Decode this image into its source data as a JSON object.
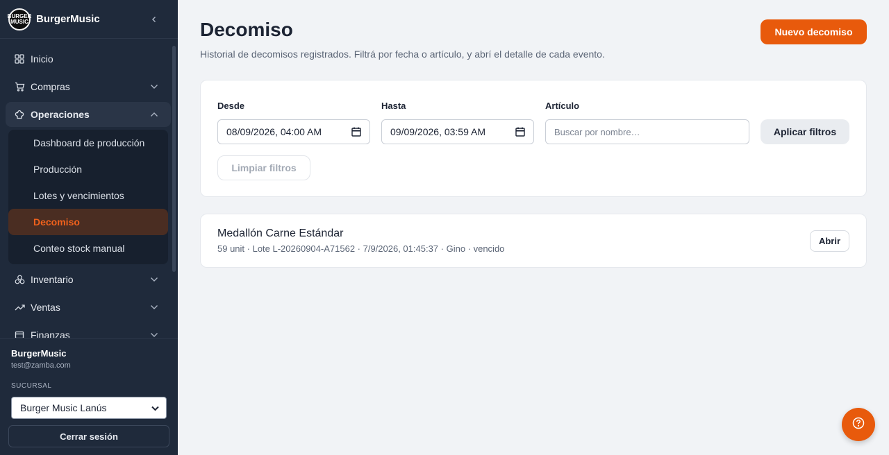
{
  "app": {
    "name": "BurgerMusic",
    "logo_text": "BURGER MUSIC"
  },
  "sidebar": {
    "items": [
      {
        "label": "Inicio",
        "icon": "grid-icon"
      },
      {
        "label": "Compras",
        "icon": "cart-icon"
      },
      {
        "label": "Operaciones",
        "icon": "chef-hat-icon",
        "expanded": true
      },
      {
        "label": "Inventario",
        "icon": "boxes-icon"
      },
      {
        "label": "Ventas",
        "icon": "trending-up-icon"
      },
      {
        "label": "Finanzas",
        "icon": "wallet-icon"
      }
    ],
    "operaciones_sub": [
      {
        "label": "Dashboard de producción"
      },
      {
        "label": "Producción"
      },
      {
        "label": "Lotes y vencimientos"
      },
      {
        "label": "Decomiso",
        "active": true
      },
      {
        "label": "Conteo stock manual"
      }
    ]
  },
  "footer": {
    "org": "BurgerMusic",
    "email": "test@zamba.com",
    "branch_label": "SUCURSAL",
    "branch_value": "Burger Music Lanús",
    "logout": "Cerrar sesión"
  },
  "page": {
    "title": "Decomiso",
    "subtitle": "Historial de decomisos registrados. Filtrá por fecha o artículo, y abrí el detalle de cada evento.",
    "new_button": "Nuevo decomiso"
  },
  "filters": {
    "from_label": "Desde",
    "from_value": "08/09/2026, 04:00 AM",
    "to_label": "Hasta",
    "to_value": "09/09/2026, 03:59 AM",
    "article_label": "Artículo",
    "article_placeholder": "Buscar por nombre…",
    "apply": "Aplicar filtros",
    "clear": "Limpiar filtros"
  },
  "events": [
    {
      "name": "Medallón Carne Estándar",
      "meta": "59 unit · Lote L-20260904-A71562 · 7/9/2026, 01:45:37 · Gino · vencido",
      "open": "Abrir"
    }
  ],
  "colors": {
    "accent": "#e85a0c",
    "sidebar_bg": "#1f2a3b"
  }
}
